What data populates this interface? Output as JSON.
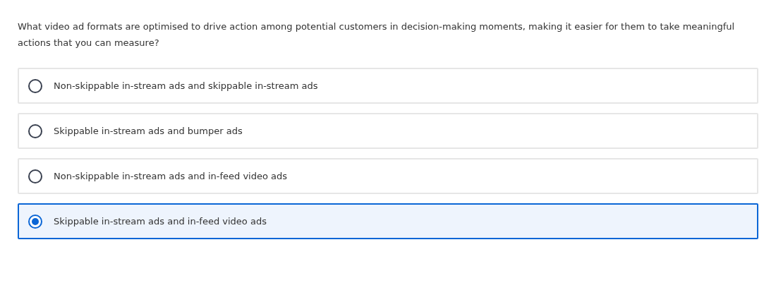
{
  "question": "What video ad formats are optimised to drive action among potential customers in decision-making moments, making it easier for them to take meaningful actions that you can measure?",
  "options": [
    {
      "label": "Non-skippable in-stream ads and skippable in-stream ads",
      "selected": false
    },
    {
      "label": "Skippable in-stream ads and bumper ads",
      "selected": false
    },
    {
      "label": "Non-skippable in-stream ads and in-feed video ads",
      "selected": false
    },
    {
      "label": "Skippable in-stream ads and in-feed video ads",
      "selected": true
    }
  ]
}
